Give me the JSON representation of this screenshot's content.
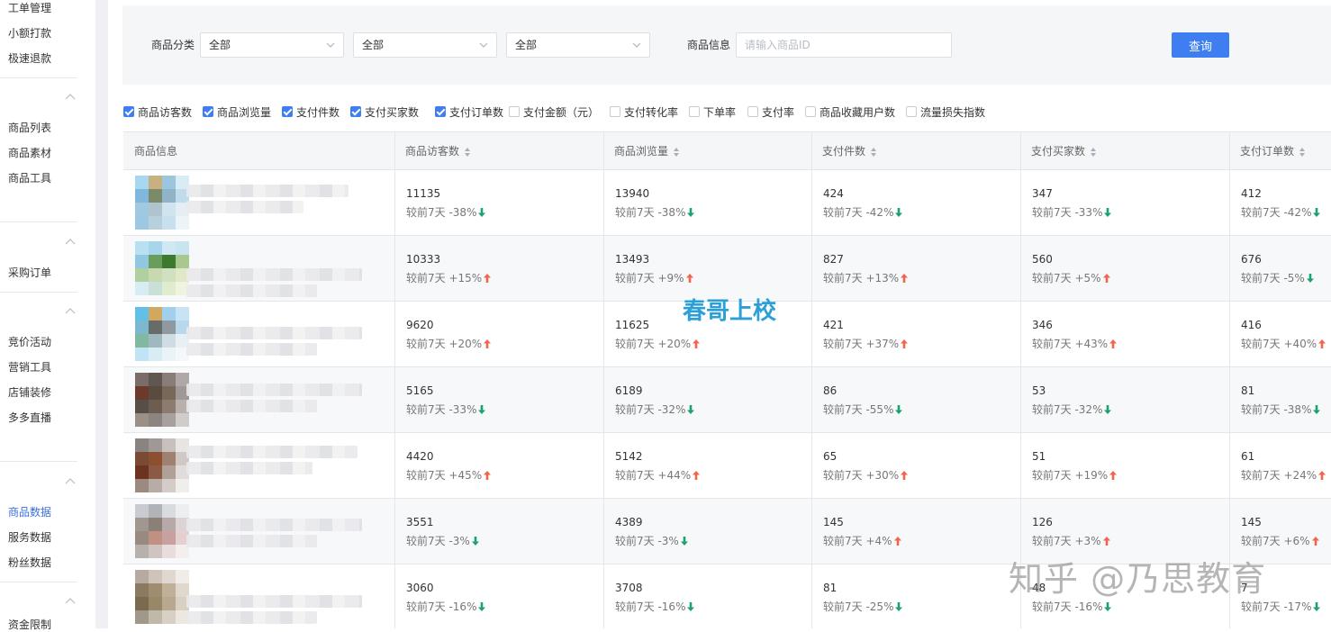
{
  "sidebar": {
    "groups": [
      {
        "items": [
          "工单管理",
          "小额打款",
          "极速退款"
        ]
      },
      {
        "items": [
          "商品列表",
          "商品素材",
          "商品工具"
        ]
      },
      {
        "items": [
          "采购订单"
        ]
      },
      {
        "items": [
          "竞价活动",
          "营销工具",
          "店铺装修",
          "多多直播"
        ]
      },
      {
        "items": [
          "商品数据",
          "服务数据",
          "粉丝数据"
        ]
      },
      {
        "items": [
          "资金限制"
        ]
      }
    ],
    "active_item": "商品数据"
  },
  "filter": {
    "category_label": "商品分类",
    "category_selects": [
      "全部",
      "全部",
      "全部"
    ],
    "info_label": "商品信息",
    "info_placeholder": "请输入商品ID",
    "query_button": "查询"
  },
  "metrics": [
    {
      "label": "商品访客数",
      "checked": true
    },
    {
      "label": "商品浏览量",
      "checked": true
    },
    {
      "label": "支付件数",
      "checked": true
    },
    {
      "label": "支付买家数",
      "checked": true
    },
    {
      "label": "支付订单数",
      "checked": true
    },
    {
      "label": "支付金额（元）",
      "checked": false
    },
    {
      "label": "支付转化率",
      "checked": false
    },
    {
      "label": "下单率",
      "checked": false
    },
    {
      "label": "支付率",
      "checked": false
    },
    {
      "label": "商品收藏用户数",
      "checked": false
    },
    {
      "label": "流量损失指数",
      "checked": false
    }
  ],
  "table": {
    "columns": [
      "商品信息",
      "商品访客数",
      "商品浏览量",
      "支付件数",
      "支付买家数",
      "支付订单数"
    ],
    "compare_prefix": "较前7天",
    "rows": [
      {
        "cells": [
          {
            "v": "11135",
            "c": "-38%",
            "d": "down"
          },
          {
            "v": "13940",
            "c": "-38%",
            "d": "down"
          },
          {
            "v": "424",
            "c": "-42%",
            "d": "down"
          },
          {
            "v": "347",
            "c": "-33%",
            "d": "down"
          },
          {
            "v": "412",
            "c": "-42%",
            "d": "down"
          }
        ]
      },
      {
        "cells": [
          {
            "v": "10333",
            "c": "+15%",
            "d": "up"
          },
          {
            "v": "13493",
            "c": "+9%",
            "d": "up"
          },
          {
            "v": "827",
            "c": "+13%",
            "d": "up"
          },
          {
            "v": "560",
            "c": "+5%",
            "d": "up"
          },
          {
            "v": "676",
            "c": "-5%",
            "d": "down"
          }
        ]
      },
      {
        "cells": [
          {
            "v": "9620",
            "c": "+20%",
            "d": "up"
          },
          {
            "v": "11625",
            "c": "+20%",
            "d": "up"
          },
          {
            "v": "421",
            "c": "+37%",
            "d": "up"
          },
          {
            "v": "346",
            "c": "+43%",
            "d": "up"
          },
          {
            "v": "416",
            "c": "+40%",
            "d": "up"
          }
        ]
      },
      {
        "cells": [
          {
            "v": "5165",
            "c": "-33%",
            "d": "down"
          },
          {
            "v": "6189",
            "c": "-32%",
            "d": "down"
          },
          {
            "v": "86",
            "c": "-55%",
            "d": "down"
          },
          {
            "v": "53",
            "c": "-32%",
            "d": "down"
          },
          {
            "v": "81",
            "c": "-38%",
            "d": "down"
          }
        ]
      },
      {
        "cells": [
          {
            "v": "4420",
            "c": "+45%",
            "d": "up"
          },
          {
            "v": "5142",
            "c": "+44%",
            "d": "up"
          },
          {
            "v": "65",
            "c": "+30%",
            "d": "up"
          },
          {
            "v": "51",
            "c": "+19%",
            "d": "up"
          },
          {
            "v": "61",
            "c": "+24%",
            "d": "up"
          }
        ]
      },
      {
        "cells": [
          {
            "v": "3551",
            "c": "-3%",
            "d": "down"
          },
          {
            "v": "4389",
            "c": "-3%",
            "d": "down"
          },
          {
            "v": "145",
            "c": "+4%",
            "d": "up"
          },
          {
            "v": "126",
            "c": "+3%",
            "d": "up"
          },
          {
            "v": "145",
            "c": "+6%",
            "d": "up"
          }
        ]
      },
      {
        "cells": [
          {
            "v": "3060",
            "c": "-16%",
            "d": "down"
          },
          {
            "v": "3708",
            "c": "-16%",
            "d": "down"
          },
          {
            "v": "81",
            "c": "-25%",
            "d": "down"
          },
          {
            "v": "48",
            "c": "-16%",
            "d": "down"
          },
          {
            "v": "7",
            "c": "-17%",
            "d": "down"
          }
        ]
      }
    ]
  },
  "colors": {
    "accent": "#3e7ef0",
    "up": "#f0654c",
    "down": "#1aa36f",
    "watermark": "#2b9fd8"
  },
  "watermarks": {
    "center": "春哥上校",
    "corner": "知乎 @乃思教育"
  }
}
